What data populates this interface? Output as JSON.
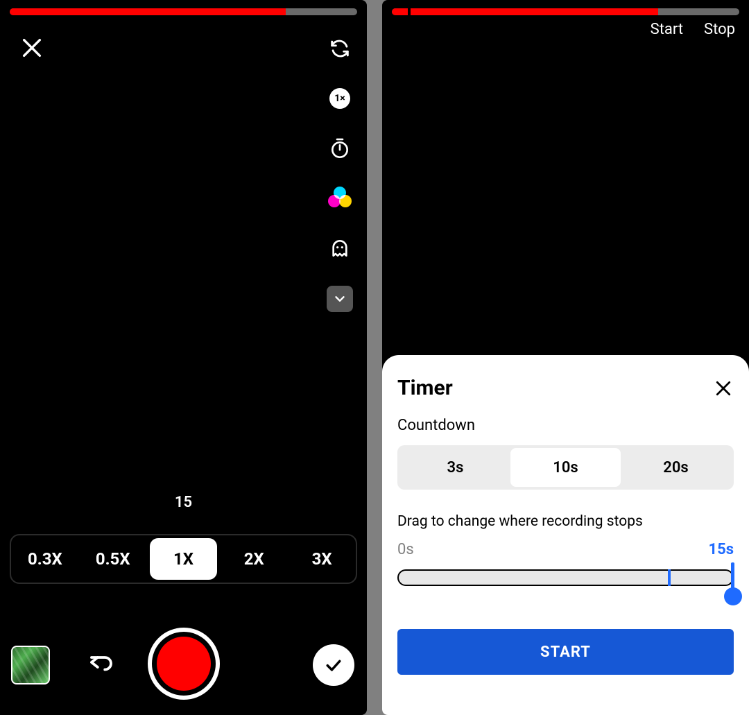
{
  "left": {
    "progress_percent": 79.4,
    "speed_label": "1×",
    "remaining_seconds": "15",
    "speeds": [
      "0.3X",
      "0.5X",
      "1X",
      "2X",
      "3X"
    ],
    "active_speed_index": 2
  },
  "right": {
    "progress_percent": 76.6,
    "tick_percent": 4.6,
    "header": {
      "start": "Start",
      "stop": "Stop"
    },
    "sheet": {
      "title": "Timer",
      "countdown_label": "Countdown",
      "options": [
        "3s",
        "10s",
        "20s"
      ],
      "active_option_index": 1,
      "drag_label": "Drag to change where recording stops",
      "range_min": "0s",
      "range_max": "15s",
      "range_mark1_percent": 80.5,
      "range_mark2_percent": 99.2,
      "start_button": "START"
    }
  }
}
